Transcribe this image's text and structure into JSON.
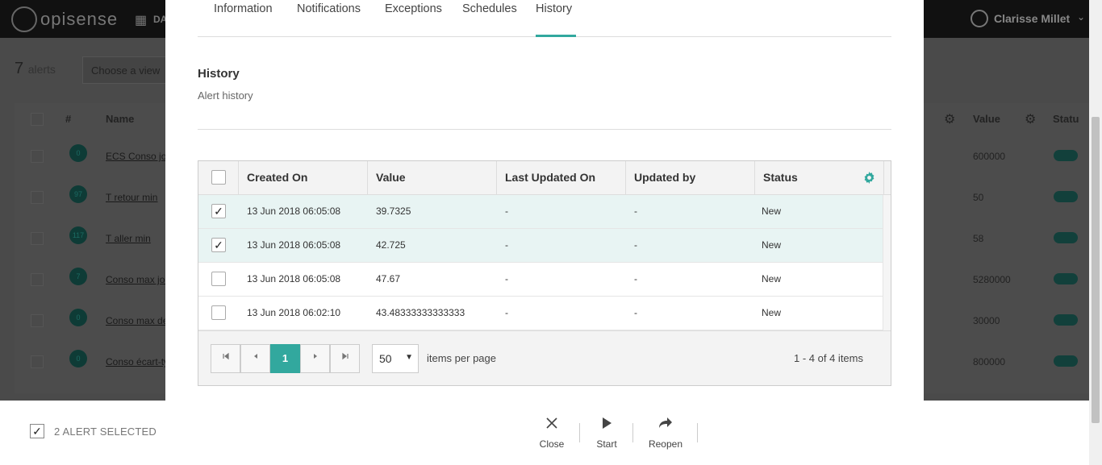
{
  "background": {
    "logo_text": "opisense",
    "nav_label": "DA",
    "user_name": "Clarisse Millet",
    "alert_count": "7",
    "alert_count_suffix": "alerts",
    "view_placeholder": "Choose a view",
    "columns": [
      "#",
      "Name",
      "Value",
      "Statu"
    ],
    "rows": [
      {
        "badge": "0",
        "name": "ECS Conso jou",
        "value": "600000"
      },
      {
        "badge": "97",
        "name": "T retour min",
        "value": "50"
      },
      {
        "badge": "117",
        "name": "T aller min",
        "value": "58"
      },
      {
        "badge": "7",
        "name": "Conso max jou",
        "value": "5280000"
      },
      {
        "badge": "0",
        "name": "Conso max de",
        "value": "30000"
      },
      {
        "badge": "0",
        "name": "Conso écart-ty",
        "value": "800000"
      }
    ]
  },
  "modal": {
    "tabs": [
      {
        "label": "Information",
        "active": false
      },
      {
        "label": "Notifications",
        "active": false
      },
      {
        "label": "Exceptions",
        "active": false
      },
      {
        "label": "Schedules",
        "active": false
      },
      {
        "label": "History",
        "active": true
      }
    ],
    "section_title": "History",
    "section_subtitle": "Alert history",
    "grid": {
      "columns": [
        "Created On",
        "Value",
        "Last Updated On",
        "Updated by",
        "Status"
      ],
      "rows": [
        {
          "checked": true,
          "created_on": "13 Jun 2018 06:05:08",
          "value": "39.7325",
          "last_updated_on": "-",
          "updated_by": "-",
          "status": "New"
        },
        {
          "checked": true,
          "created_on": "13 Jun 2018 06:05:08",
          "value": "42.725",
          "last_updated_on": "-",
          "updated_by": "-",
          "status": "New"
        },
        {
          "checked": false,
          "created_on": "13 Jun 2018 06:05:08",
          "value": "47.67",
          "last_updated_on": "-",
          "updated_by": "-",
          "status": "New"
        },
        {
          "checked": false,
          "created_on": "13 Jun 2018 06:02:10",
          "value": "43.48333333333333",
          "last_updated_on": "-",
          "updated_by": "-",
          "status": "New"
        }
      ],
      "pager": {
        "current_page": "1",
        "page_size": "50",
        "items_per_page_label": "items per page",
        "info": "1 - 4 of 4 items"
      }
    }
  },
  "bottom_bar": {
    "selected_label": "2 ALERT SELECTED",
    "actions": {
      "close": "Close",
      "start": "Start",
      "reopen": "Reopen"
    }
  },
  "colors": {
    "accent": "#32a89e",
    "selected_row": "#e8f4f3"
  }
}
